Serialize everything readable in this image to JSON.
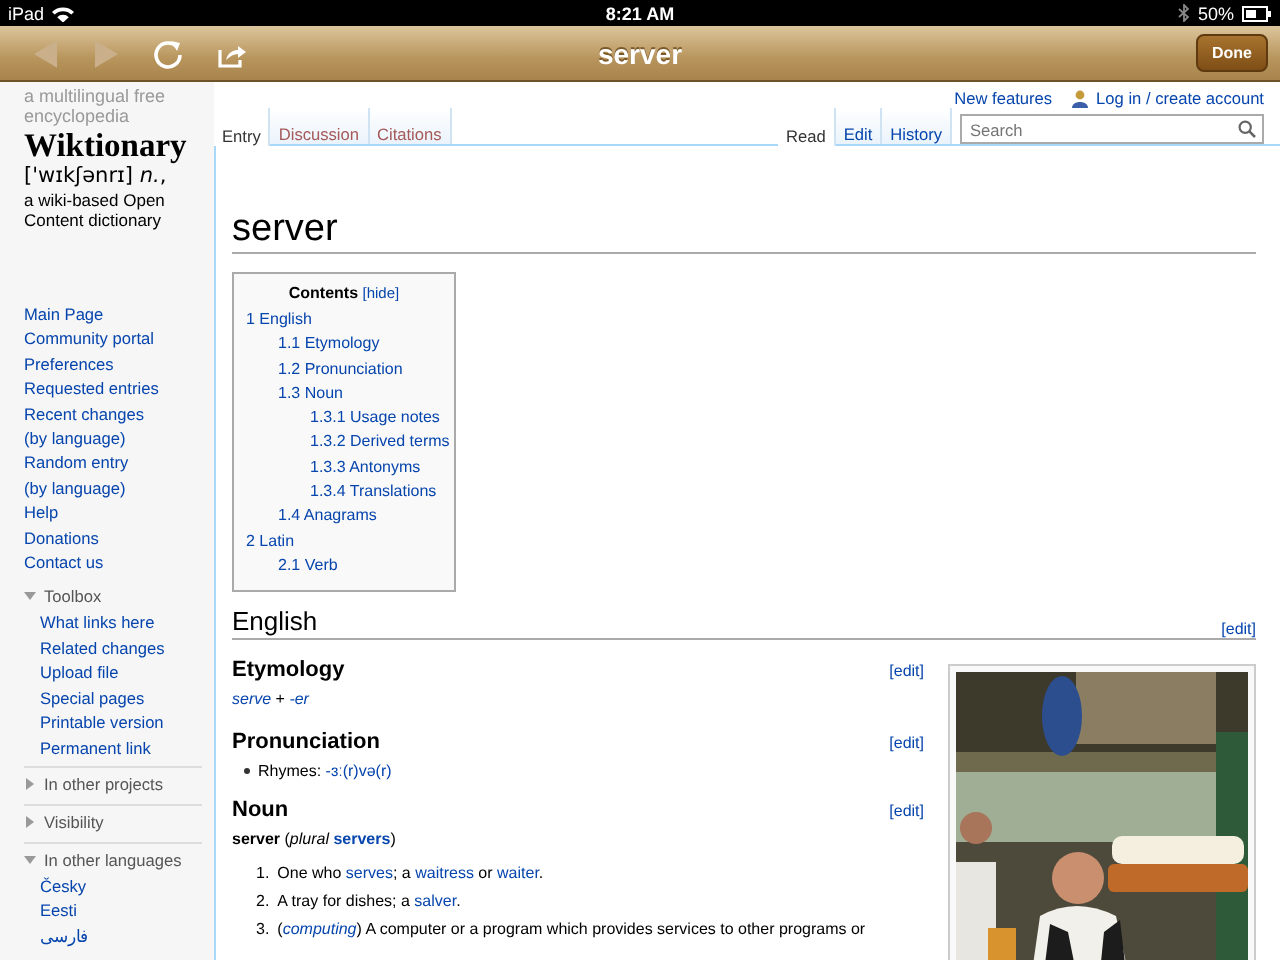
{
  "status_bar": {
    "device": "iPad",
    "time": "8:21 AM",
    "battery": "50%"
  },
  "browser_bar": {
    "title": "server",
    "done": "Done",
    "buttons": [
      {
        "kind": "back",
        "disabled": true
      },
      {
        "kind": "forward",
        "disabled": true
      },
      {
        "kind": "reload",
        "disabled": false
      },
      {
        "kind": "share",
        "disabled": false
      }
    ]
  },
  "logo": {
    "tagline": [
      "a multilingual free",
      "encyclopedia"
    ],
    "name": "Wiktionary",
    "pronunciation": "['wɪkʃənrɪ] *n.*,",
    "description": [
      "a wiki-based Open",
      "Content dictionary"
    ]
  },
  "sidebar": {
    "navigation": [
      "Main Page",
      "Community portal",
      "Preferences",
      "Requested entries",
      "Recent changes",
      "(by language)",
      "Random entry",
      "(by language)",
      "Help",
      "Donations",
      "Contact us"
    ],
    "portlets": [
      {
        "title": "Toolbox",
        "expanded": true,
        "items": [
          "What links here",
          "Related changes",
          "Upload file",
          "Special pages",
          "Printable version",
          "Permanent link"
        ]
      },
      {
        "title": "In other projects",
        "expanded": false
      },
      {
        "title": "Visibility",
        "expanded": false
      },
      {
        "title": "In other languages",
        "expanded": true,
        "items": [
          "Česky",
          "Eesti",
          "فارسی"
        ]
      }
    ]
  },
  "personal_links": [
    {
      "label": "New features",
      "kind": "link"
    },
    {
      "label": "Log in / create account",
      "kind": "login"
    }
  ],
  "tabs_left": [
    {
      "label": "Entry",
      "selected": true,
      "exists": true
    },
    {
      "label": "Discussion",
      "selected": false,
      "exists": false
    },
    {
      "label": "Citations",
      "selected": false,
      "exists": false
    }
  ],
  "tabs_right": [
    {
      "label": "Read",
      "selected": true
    },
    {
      "label": "Edit",
      "selected": false
    },
    {
      "label": "History",
      "selected": false
    }
  ],
  "search": {
    "placeholder": "Search"
  },
  "page_title": "server",
  "toc": {
    "title": "Contents",
    "toggle": "[hide]",
    "items": [
      {
        "number": "1",
        "label": "English",
        "children": [
          {
            "number": "1.1",
            "label": "Etymology"
          },
          {
            "number": "1.2",
            "label": "Pronunciation"
          },
          {
            "number": "1.3",
            "label": "Noun",
            "children": [
              {
                "number": "1.3.1",
                "label": "Usage notes"
              },
              {
                "number": "1.3.2",
                "label": "Derived terms"
              },
              {
                "number": "1.3.3",
                "label": "Antonyms"
              },
              {
                "number": "1.3.4",
                "label": "Translations"
              }
            ]
          },
          {
            "number": "1.4",
            "label": "Anagrams"
          }
        ]
      },
      {
        "number": "2",
        "label": "Latin",
        "children": [
          {
            "number": "2.1",
            "label": "Verb"
          }
        ]
      }
    ]
  },
  "sections": [
    {
      "heading": "English",
      "edit": "[edit]",
      "image": {
        "kind": "picture"
      },
      "subsections": [
        {
          "heading": "Etymology",
          "edit": "[edit]",
          "blocks": [
            {
              "kind": "paragraph",
              "segments": [
                {
                  "text": "serve",
                  "link": true,
                  "italic": true
                },
                {
                  "text": " + "
                },
                {
                  "text": "-er",
                  "link": true,
                  "italic": true
                }
              ]
            }
          ]
        },
        {
          "heading": "Pronunciation",
          "edit": "[edit]",
          "blocks": [
            {
              "kind": "bullets",
              "items": [
                [
                  {
                    "text": "Rhymes: "
                  },
                  {
                    "text": "-ɜː(r)və(r)",
                    "link": true
                  }
                ]
              ]
            }
          ]
        },
        {
          "heading": "Noun",
          "edit": "[edit]",
          "blocks": [
            {
              "kind": "paragraph",
              "segments": [
                {
                  "text": "server",
                  "bold": true
                },
                {
                  "text": " ("
                },
                {
                  "text": "plural ",
                  "italic": true
                },
                {
                  "text": "servers",
                  "link": true,
                  "bold": true
                },
                {
                  "text": ")"
                }
              ]
            },
            {
              "kind": "numbered",
              "items": [
                {
                  "number": "1.",
                  "segments": [
                    {
                      "text": "One who "
                    },
                    {
                      "text": "serves",
                      "link": true
                    },
                    {
                      "text": "; a "
                    },
                    {
                      "text": "waitress",
                      "link": true
                    },
                    {
                      "text": " or "
                    },
                    {
                      "text": "waiter",
                      "link": true
                    },
                    {
                      "text": "."
                    }
                  ]
                },
                {
                  "number": "2.",
                  "segments": [
                    {
                      "text": "A tray for dishes; a "
                    },
                    {
                      "text": "salver",
                      "link": true
                    },
                    {
                      "text": "."
                    }
                  ]
                },
                {
                  "number": "3.",
                  "segments": [
                    {
                      "text": "("
                    },
                    {
                      "text": "computing",
                      "link": true,
                      "italic": true
                    },
                    {
                      "text": ") A computer or a program which provides services to other programs or"
                    }
                  ]
                }
              ]
            }
          ]
        }
      ]
    }
  ]
}
